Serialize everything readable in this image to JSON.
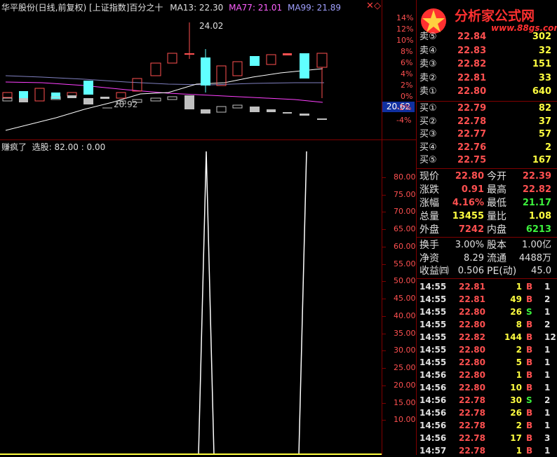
{
  "header": {
    "stock": "华平股份(日线,前复权)",
    "index": "[上证指数]",
    "indicator": "百分之十",
    "ma13": "MA13: 22.30",
    "ma77": "MA77: 21.01",
    "ma99": "MA99: 21.89"
  },
  "watermark": {
    "brand": "分析家公式网",
    "url": "www.88gs.com"
  },
  "price_chart": {
    "high_label": "24.02",
    "low_label": "20.92",
    "current_price_tag": "20.62",
    "right_axis": [
      "14%",
      "12%",
      "10%",
      "8%",
      "6%",
      "4%",
      "2%",
      "0%",
      "-2%",
      "-4%"
    ]
  },
  "indicator_panel": {
    "title": "赚疯了  选股: 82.00 : 0.00",
    "axis": [
      "80.00",
      "75.00",
      "70.00",
      "65.00",
      "60.00",
      "55.00",
      "50.00",
      "45.00",
      "40.00",
      "35.00",
      "30.00",
      "25.00",
      "20.00",
      "15.00",
      "10.00"
    ]
  },
  "chart_data": {
    "type": "line",
    "title": "赚疯了",
    "series": [
      {
        "name": "选股",
        "values": [
          0,
          0,
          0,
          0,
          0,
          0,
          0,
          0,
          0,
          0,
          0,
          0,
          0,
          0,
          0,
          0,
          0,
          0,
          0,
          0,
          0,
          0,
          0,
          0,
          0,
          0,
          0,
          0,
          0,
          100,
          0,
          0,
          0,
          0,
          0,
          0,
          0,
          0,
          0,
          0,
          0,
          0,
          100
        ]
      }
    ],
    "ylim": [
      0,
      85
    ],
    "grid": false
  },
  "order_book": {
    "asks": [
      {
        "label": "卖⑤",
        "price": "22.84",
        "vol": "302"
      },
      {
        "label": "卖④",
        "price": "22.83",
        "vol": "32"
      },
      {
        "label": "卖③",
        "price": "22.82",
        "vol": "151"
      },
      {
        "label": "卖②",
        "price": "22.81",
        "vol": "33"
      },
      {
        "label": "卖①",
        "price": "22.80",
        "vol": "640"
      }
    ],
    "bids": [
      {
        "label": "买①",
        "price": "22.79",
        "vol": "82"
      },
      {
        "label": "买②",
        "price": "22.78",
        "vol": "37"
      },
      {
        "label": "买③",
        "price": "22.77",
        "vol": "57"
      },
      {
        "label": "买④",
        "price": "22.76",
        "vol": "2"
      },
      {
        "label": "买⑤",
        "price": "22.75",
        "vol": "167"
      }
    ]
  },
  "quote": {
    "rows": [
      {
        "l1": "现价",
        "v1": "22.80",
        "l2": "今开",
        "v2": "22.39"
      },
      {
        "l1": "涨跌",
        "v1": "0.91",
        "l2": "最高",
        "v2": "22.82"
      },
      {
        "l1": "涨幅",
        "v1": "4.16%",
        "l2": "最低",
        "v2": "21.17"
      },
      {
        "l1": "总量",
        "v1": "13455",
        "l2": "量比",
        "v2": "1.08"
      },
      {
        "l1": "外盘",
        "v1": "7242",
        "l2": "内盘",
        "v2": "6213"
      }
    ]
  },
  "fundamentals": {
    "rows": [
      {
        "l1": "换手",
        "v1": "3.00%",
        "l2": "股本",
        "v2": "1.00亿"
      },
      {
        "l1": "净资",
        "v1": "8.29",
        "l2": "流通",
        "v2": "4488万"
      },
      {
        "l1": "收益㈣",
        "v1": "0.506",
        "l2": "PE(动)",
        "v2": "45.0"
      }
    ]
  },
  "ticks": [
    {
      "t": "14:55",
      "p": "22.81",
      "v": "1",
      "s": "B",
      "n": "1"
    },
    {
      "t": "14:55",
      "p": "22.81",
      "v": "49",
      "s": "B",
      "n": "2"
    },
    {
      "t": "14:55",
      "p": "22.80",
      "v": "26",
      "s": "S",
      "n": "1"
    },
    {
      "t": "14:55",
      "p": "22.80",
      "v": "8",
      "s": "B",
      "n": "2"
    },
    {
      "t": "14:55",
      "p": "22.82",
      "v": "144",
      "s": "B",
      "n": "12"
    },
    {
      "t": "14:55",
      "p": "22.80",
      "v": "2",
      "s": "B",
      "n": "1"
    },
    {
      "t": "14:55",
      "p": "22.80",
      "v": "5",
      "s": "B",
      "n": "1"
    },
    {
      "t": "14:56",
      "p": "22.80",
      "v": "1",
      "s": "B",
      "n": "1"
    },
    {
      "t": "14:56",
      "p": "22.80",
      "v": "10",
      "s": "B",
      "n": "1"
    },
    {
      "t": "14:56",
      "p": "22.78",
      "v": "30",
      "s": "S",
      "n": "2"
    },
    {
      "t": "14:56",
      "p": "22.78",
      "v": "26",
      "s": "B",
      "n": "1"
    },
    {
      "t": "14:56",
      "p": "22.78",
      "v": "2",
      "s": "B",
      "n": "1"
    },
    {
      "t": "14:56",
      "p": "22.78",
      "v": "17",
      "s": "B",
      "n": "3"
    },
    {
      "t": "14:57",
      "p": "22.78",
      "v": "1",
      "s": "B",
      "n": "1"
    }
  ]
}
